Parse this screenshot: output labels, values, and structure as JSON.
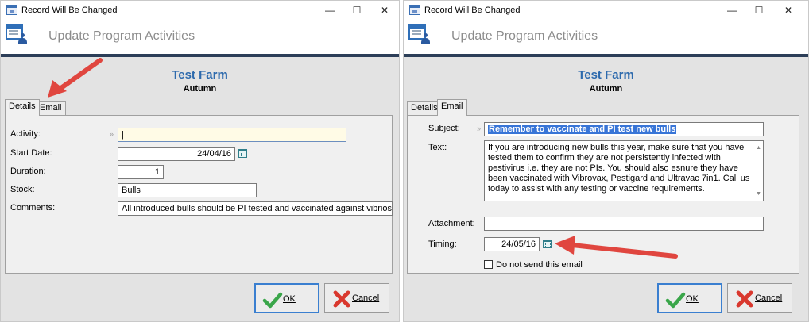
{
  "windows": [
    {
      "title": "Record Will Be Changed",
      "header": "Update Program Activities",
      "farm": "Test Farm",
      "season": "Autumn",
      "tabs": [
        {
          "label": "Details",
          "active": true
        },
        {
          "label": "Email",
          "active": false
        }
      ],
      "fields": {
        "activity_label": "Activity:",
        "activity_value": "|",
        "start_date_label": "Start Date:",
        "start_date_value": "24/04/16",
        "duration_label": "Duration:",
        "duration_value": "1",
        "stock_label": "Stock:",
        "stock_value": "Bulls",
        "comments_label": "Comments:",
        "comments_value": "All introduced bulls should be PI tested and  vaccinated against vibriosis , |"
      },
      "buttons": {
        "ok": "OK",
        "cancel": "Cancel"
      }
    },
    {
      "title": "Record Will Be Changed",
      "header": "Update Program Activities",
      "farm": "Test Farm",
      "season": "Autumn",
      "tabs": [
        {
          "label": "Details",
          "active": false
        },
        {
          "label": "Email",
          "active": true
        }
      ],
      "fields": {
        "subject_label": "Subject:",
        "subject_value": "Remember to vaccinate and PI test new bulls",
        "text_label": "Text:",
        "text_value": "If you are introducing new bulls this year, make sure that you have tested them to confirm they are not persistently infected with pestivirus i.e. they are not PIs. You should also esnure they have been vaccinated with Vibrovax, Pestigard and Ultravac 7in1. Call us today to assist with any testing or vaccine requirements.",
        "attachment_label": "Attachment:",
        "attachment_value": "",
        "timing_label": "Timing:",
        "timing_value": "24/05/16",
        "do_not_send_label": "Do not send this email",
        "do_not_send_checked": false
      },
      "buttons": {
        "ok": "OK",
        "cancel": "Cancel"
      }
    }
  ],
  "window_controls": {
    "minimize": "—",
    "maximize": "☐",
    "close": "✕"
  },
  "colors": {
    "accent_blue": "#2d6aad",
    "header_bar": "#2c3e58",
    "annotation_arrow": "#e0463f",
    "selection": "#3875d7"
  },
  "icons": {
    "window": "window-form-icon",
    "header": "program-activity-icon",
    "calendar": "calendar-icon",
    "ok": "green-check-icon",
    "cancel": "red-x-icon"
  }
}
